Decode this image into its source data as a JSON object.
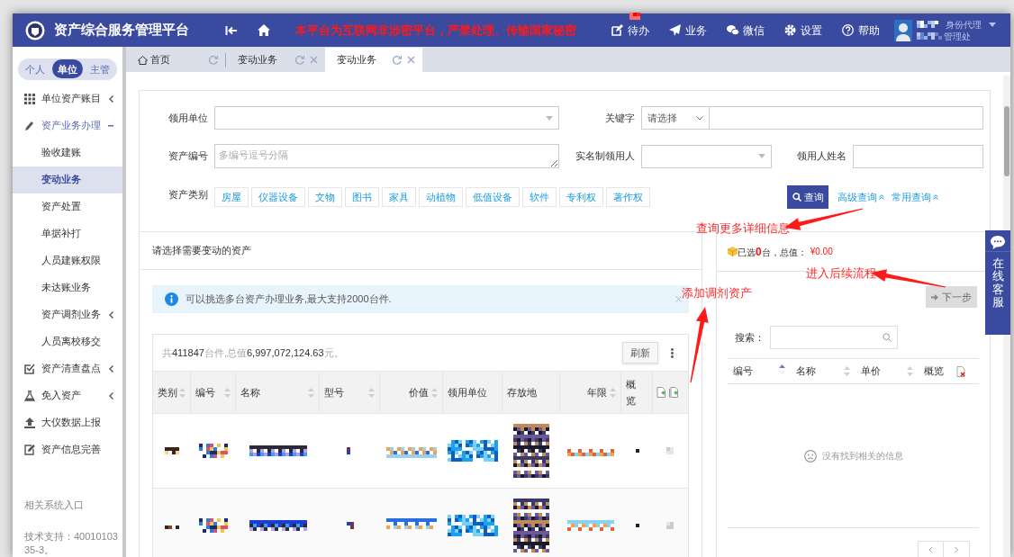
{
  "header": {
    "title": "资产综合服务管理平台",
    "notice": "本平台为互联网非涉密平台，严禁处理、传输国家秘密",
    "nav": [
      {
        "label": "待办",
        "badge_redacted": true
      },
      {
        "label": "业务"
      },
      {
        "label": "微信"
      },
      {
        "label": "设置"
      },
      {
        "label": "帮助"
      }
    ],
    "user": {
      "role_link": "身份代理",
      "department": "管理处",
      "name_redacted": true
    }
  },
  "scope_tabs": [
    {
      "label": "个人",
      "selected": false
    },
    {
      "label": "单位",
      "selected": true
    },
    {
      "label": "主管",
      "selected": false
    }
  ],
  "menu": [
    {
      "label": "单位资产账目",
      "expanded": false
    },
    {
      "label": "资产业务办理",
      "expanded": true,
      "children": [
        {
          "label": "验收建账",
          "selected": false
        },
        {
          "label": "变动业务",
          "selected": true
        },
        {
          "label": "资产处置",
          "selected": false
        },
        {
          "label": "单据补打",
          "selected": false
        },
        {
          "label": "人员建账权限",
          "selected": false
        },
        {
          "label": "未达账业务",
          "selected": false
        },
        {
          "label": "资产调剂业务",
          "selected": false,
          "expanded": false
        },
        {
          "label": "人员离校移交",
          "selected": false
        }
      ]
    },
    {
      "label": "资产清查盘点",
      "expanded": false
    },
    {
      "label": "免入资产",
      "expanded": false
    },
    {
      "label": "大仪数据上报"
    },
    {
      "label": "资产信息完善"
    }
  ],
  "sidebar_footer": {
    "links_heading": "相关系统入口",
    "support": "技术支持：4001010335-3。"
  },
  "tabs": [
    {
      "label": "首页",
      "kind": "home",
      "selected": false,
      "closable": false
    },
    {
      "label": "变动业务",
      "kind": "page",
      "selected": false,
      "closable": true
    },
    {
      "label": "变动业务",
      "kind": "page",
      "selected": true,
      "closable": true
    }
  ],
  "search": {
    "unit": {
      "label": "领用单位"
    },
    "keyword": {
      "label": "关键字",
      "select_placeholder": "请选择"
    },
    "asset_no": {
      "label": "资产编号",
      "placeholder": "多编号逗号分隔"
    },
    "holder": {
      "label": "实名制领用人"
    },
    "holder_name": {
      "label": "领用人姓名"
    },
    "category_label": "资产类别",
    "categories": [
      "房屋",
      "仪器设备",
      "文物",
      "图书",
      "家具",
      "动植物",
      "低值设备",
      "软件",
      "专利权",
      "著作权"
    ],
    "query_button": "查询",
    "advanced_link": "高级查询",
    "common_link": "常用查询"
  },
  "asset_panel": {
    "title": "请选择需要变动的资产",
    "notice": "可以挑选多台资产办理业务,最大支持2000台件.",
    "summary": "共**411847**台件,总值**6,997,072,124.63**元。",
    "refresh_button": "刷新",
    "columns": [
      {
        "label": "类别",
        "sortable": true
      },
      {
        "label": "编号",
        "sortable": true
      },
      {
        "label": "名称",
        "sortable": true
      },
      {
        "label": "型号",
        "sortable": true
      },
      {
        "label": "价值",
        "sortable": true
      },
      {
        "label": "领用单位",
        "sortable": false
      },
      {
        "label": "存放地",
        "sortable": false
      },
      {
        "label": "年限",
        "sortable": true
      },
      {
        "label": "概览",
        "sortable": false
      }
    ],
    "rows": [
      {
        "redacted": true
      },
      {
        "redacted": true
      }
    ]
  },
  "selected_panel": {
    "summary": "已选**0**台，总值：",
    "total": "¥0.00",
    "next_button": "下一步",
    "next_disabled": true,
    "search_label": "搜索：",
    "columns": [
      {
        "label": "编号",
        "sortable": true,
        "sorted": true
      },
      {
        "label": "名称",
        "sortable": true,
        "sorted": false
      },
      {
        "label": "单价",
        "sortable": true,
        "sorted": false
      },
      {
        "label": "概览",
        "sortable": false,
        "sorted": false
      }
    ],
    "empty_message": "没有找到相关的信息"
  },
  "chat_widget": {
    "label": "在线客服"
  },
  "annotations": [
    {
      "text": "查询更多详细信息"
    },
    {
      "text": "进入后续流程"
    },
    {
      "text": "添加调剂资产"
    }
  ]
}
